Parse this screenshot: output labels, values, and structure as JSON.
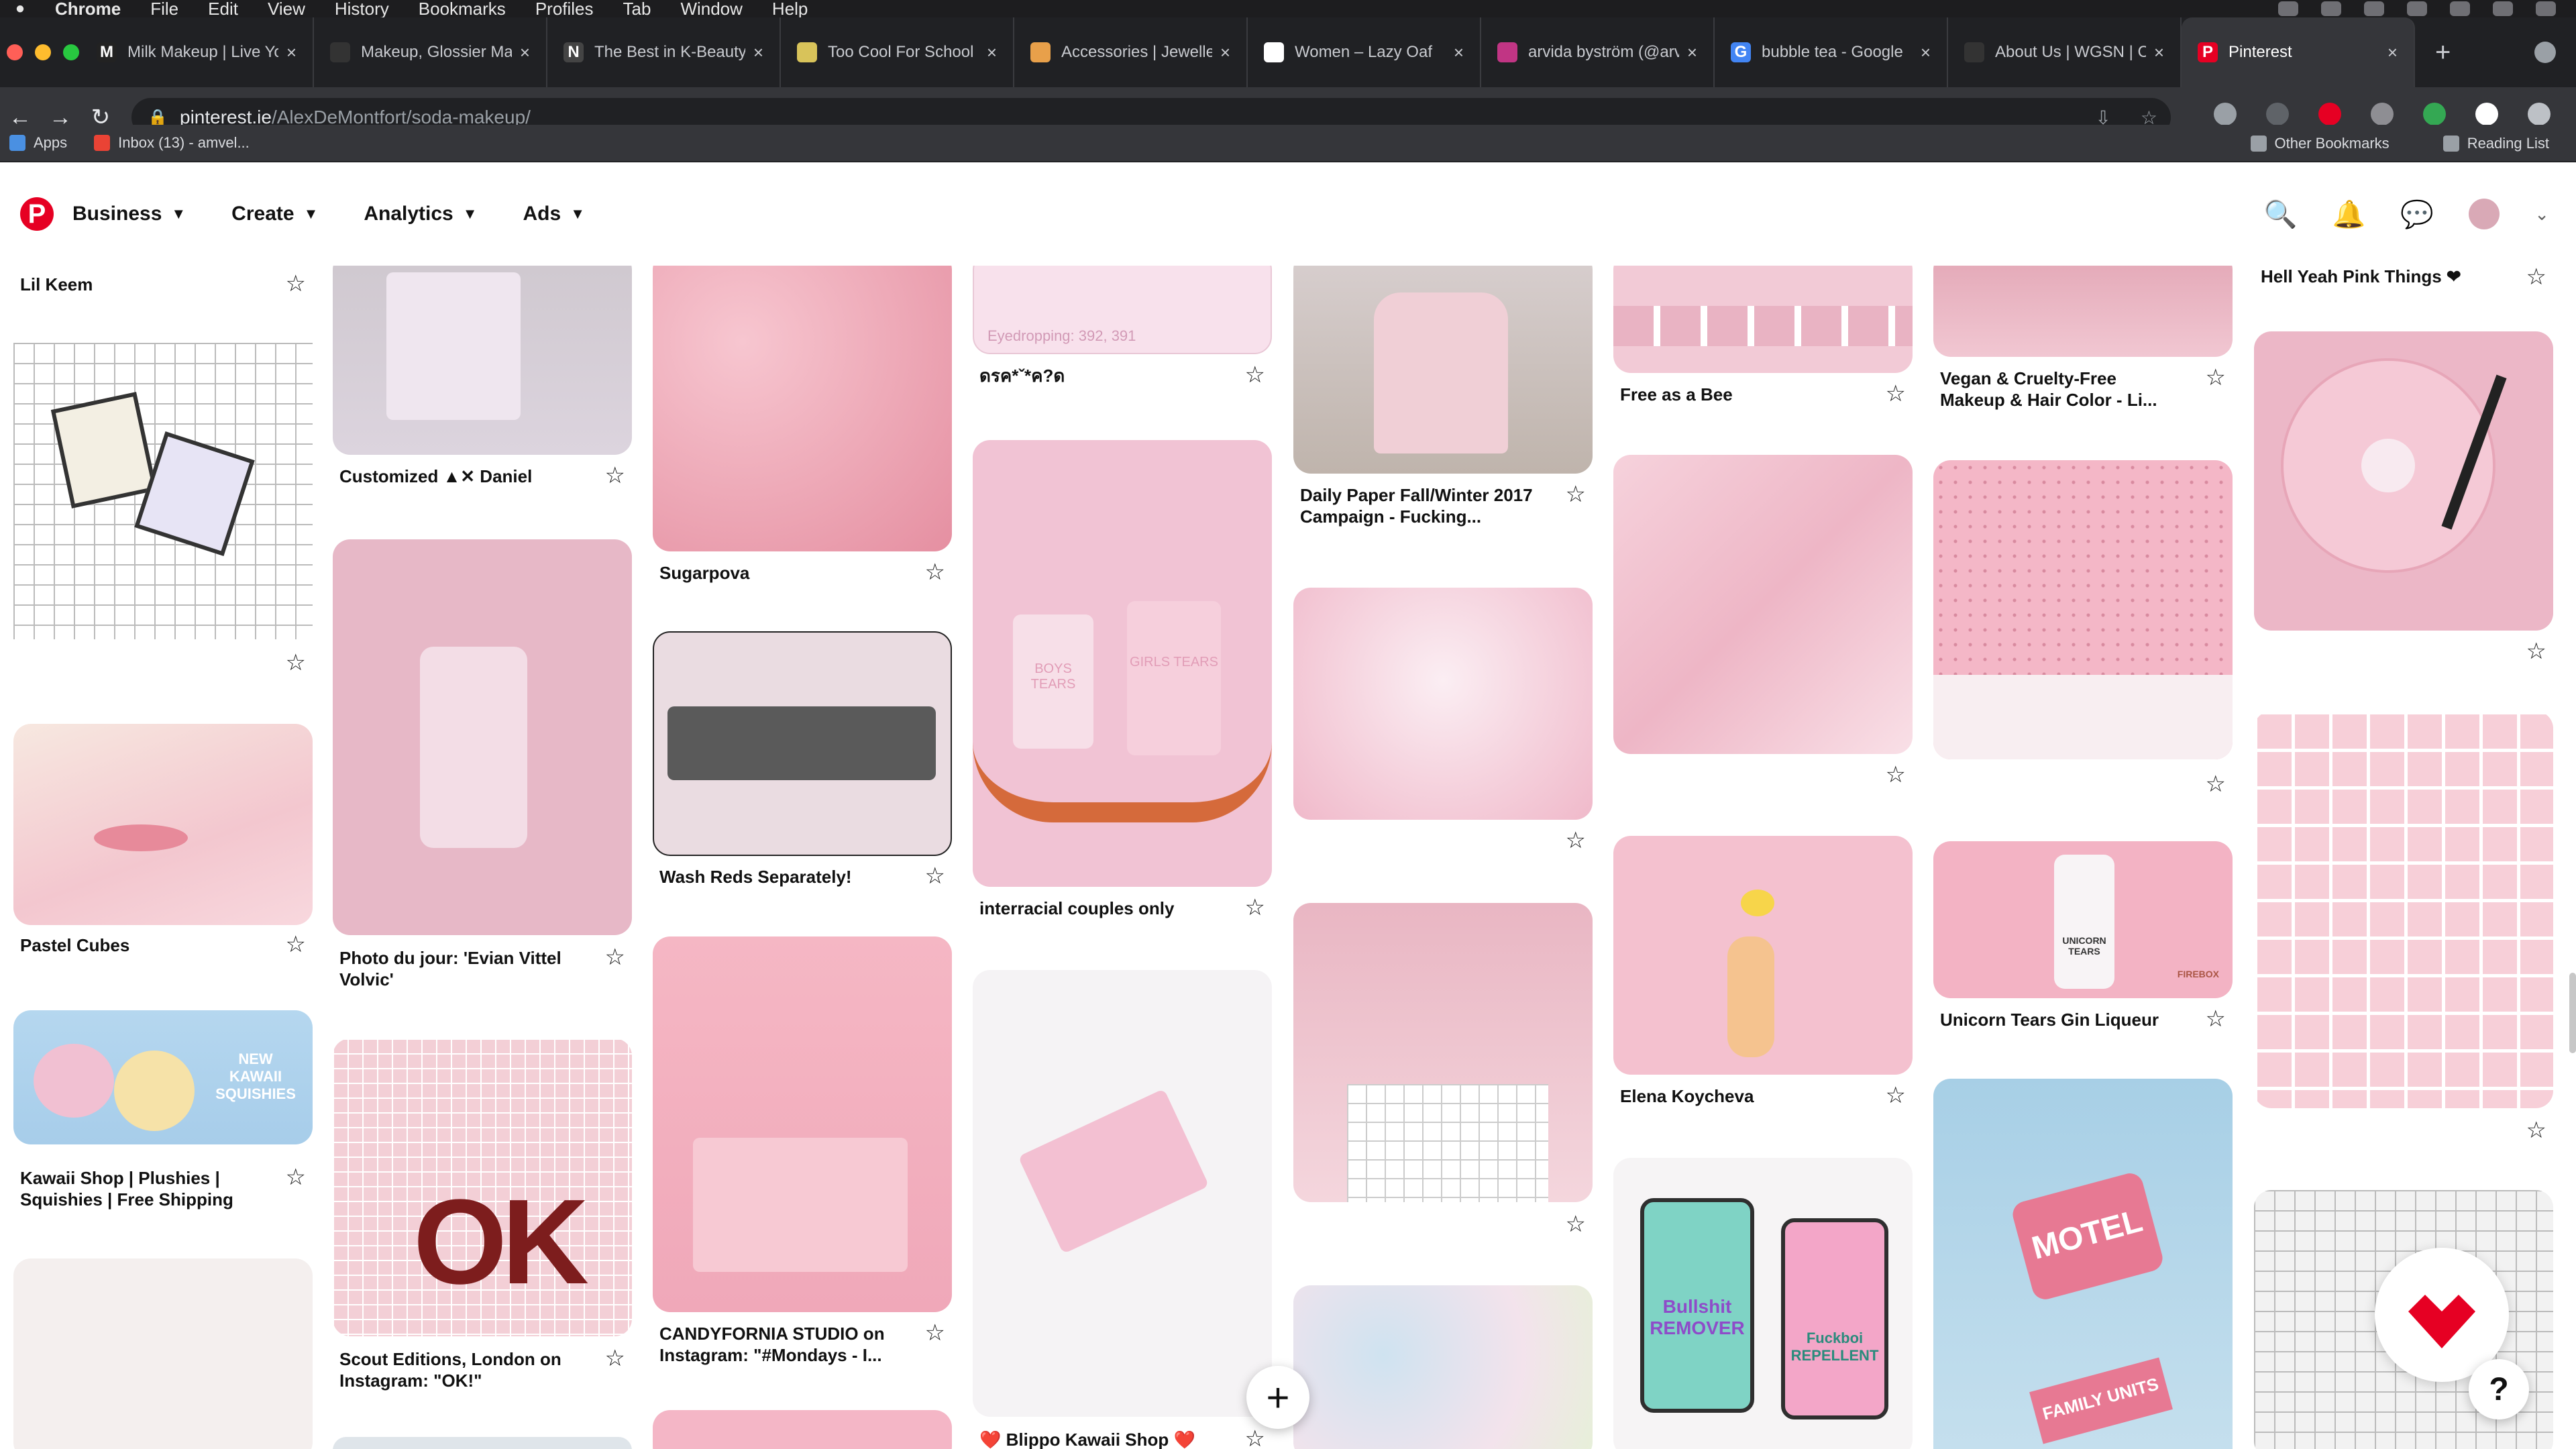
{
  "menubar": {
    "apple": "",
    "items": [
      "Chrome",
      "File",
      "Edit",
      "View",
      "History",
      "Bookmarks",
      "Profiles",
      "Tab",
      "Window",
      "Help"
    ]
  },
  "tabs": [
    {
      "label": "Milk Makeup | Live Yo",
      "fav": "M",
      "color": "#222"
    },
    {
      "label": "Makeup, Glossier Mal",
      "fav": "",
      "color": "#333"
    },
    {
      "label": "The Best in K-Beauty",
      "fav": "N",
      "color": "#444"
    },
    {
      "label": "Too Cool For School",
      "fav": "",
      "color": "#d8c35a"
    },
    {
      "label": "Accessories | Jewelle",
      "fav": "",
      "color": "#e8a04a"
    },
    {
      "label": "Women – Lazy Oaf",
      "fav": "",
      "color": "#fff"
    },
    {
      "label": "arvida byström (@arv",
      "fav": "",
      "color": "#c13584"
    },
    {
      "label": "bubble tea - Google",
      "fav": "G",
      "color": "#4285f4"
    },
    {
      "label": "About Us | WGSN | C",
      "fav": "",
      "color": "#333"
    },
    {
      "label": "Pinterest",
      "fav": "P",
      "color": "#e60023",
      "active": true
    }
  ],
  "address": {
    "host": "pinterest.ie",
    "path": "/AlexDeMontfort/soda-makeup/"
  },
  "bookmarks": {
    "apps": "Apps",
    "inbox": "Inbox (13) - amvel...",
    "other": "Other Bookmarks",
    "reading": "Reading List"
  },
  "pinterest": {
    "menus": [
      "Business",
      "Create",
      "Analytics",
      "Ads"
    ]
  },
  "pins": {
    "c1": [
      "Lil Keem",
      "",
      "Pastel Cubes",
      "Kawaii Shop | Plushies | Squishies | Free Shipping",
      ""
    ],
    "c2": [
      "Customized ▲✕ Daniel",
      "Photo du jour: 'Evian Vittel Volvic'",
      "Scout Editions, London on Instagram: \"OK!\""
    ],
    "c3": [
      "Sugarpova",
      "Wash Reds Separately!",
      "CANDYFORNIA STUDIO on Instagram: \"#Mondays - I..."
    ],
    "c4": [
      "ดรค*ˇ*ค?ด",
      "interracial couples only",
      "❤️ Blippo Kawaii Shop ❤️"
    ],
    "c5": [
      "Daily Paper Fall/Winter 2017 Campaign - Fucking...",
      "",
      ""
    ],
    "c6": [
      "Free as a Bee",
      "",
      "Elena Koycheva"
    ],
    "c7": [
      "Vegan & Cruelty-Free Makeup & Hair Color - Li...",
      "",
      "Unicorn Tears Gin Liqueur"
    ],
    "c8": [
      "Hell Yeah Pink Things ❤",
      "",
      ""
    ]
  },
  "pin_art": {
    "ok_sign": "OK",
    "eyedrop": "Eyedropping: 392, 391",
    "boys_tears": "BOYS TEARS",
    "girls_tears": "GIRLS TEARS",
    "bullshit": "Bullshit REMOVER",
    "fuckboi": "Fuckboi REPELLENT",
    "motel": "MOTEL",
    "family_units": "FAMILY UNITS",
    "unicorn_tears": "UNICORN TEARS",
    "firebox": "FIREBOX",
    "kawaii": "NEW KAWAII SQUISHIES"
  },
  "fab": {
    "plus": "+",
    "help": "?"
  }
}
